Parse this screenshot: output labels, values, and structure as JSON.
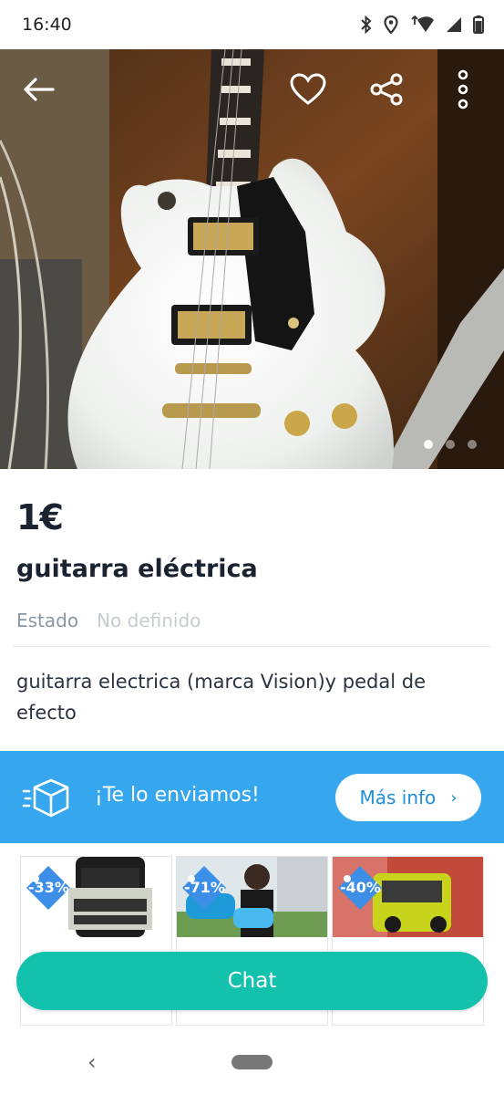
{
  "status_bar": {
    "time": "16:40"
  },
  "hero": {
    "icons": [
      "arrow-left-icon",
      "heart-icon",
      "share-icon",
      "more-vertical-icon"
    ],
    "carousel": {
      "count": 3,
      "active_index": 0
    }
  },
  "item": {
    "price": "1€",
    "title": "guitarra eléctrica",
    "state_label": "Estado",
    "state_value": "No definido",
    "description": "guitarra electrica (marca Vision)y pedal de efecto"
  },
  "shipping": {
    "text": "¡Te lo enviamos!",
    "button_label": "Más info",
    "chevron": "›",
    "color": "#36a6ee"
  },
  "ads": [
    {
      "discount": "-33%"
    },
    {
      "discount": "-71%"
    },
    {
      "discount": "-40%"
    }
  ],
  "chat": {
    "label": "Chat",
    "color": "#14c1ad"
  },
  "nav": {
    "back_glyph": "‹"
  }
}
